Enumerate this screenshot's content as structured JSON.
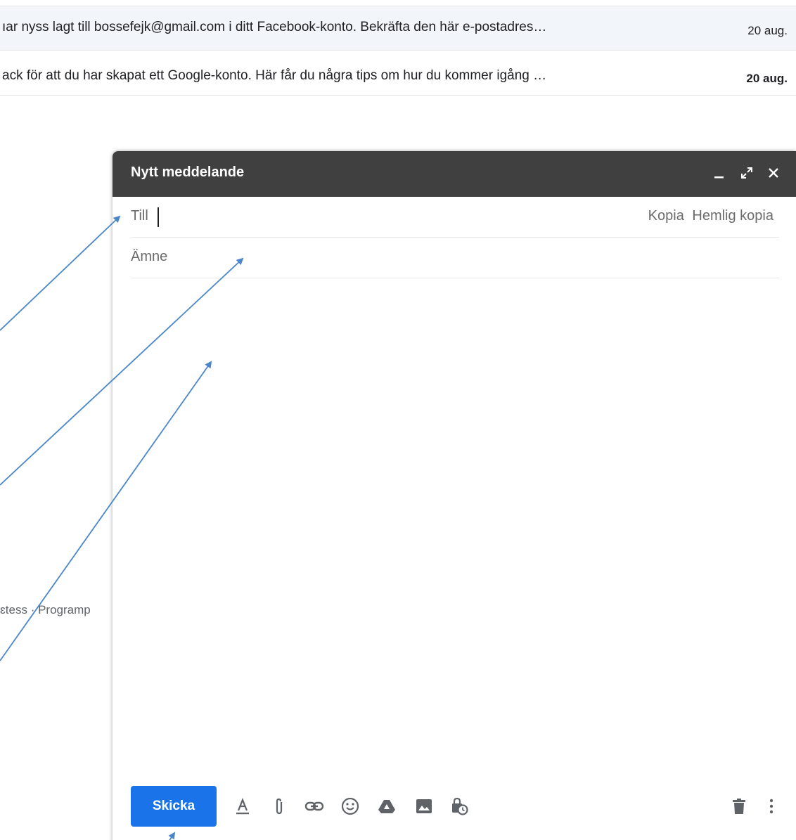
{
  "inbox": {
    "rows": [
      {
        "snippet": "ıar nyss lagt till bossefejk@gmail.com i ditt Facebook-konto. Bekräfta den här e-postadres…",
        "date": "20 aug.",
        "unread": false
      },
      {
        "snippet": "ack för att du har skapat ett Google-konto. Här får du några tips om hur du kommer igång …",
        "date": "20 aug.",
        "unread": true
      }
    ],
    "footer_text": "ɛtess · Programp"
  },
  "compose": {
    "title": "Nytt meddelande",
    "header_icons": [
      "minimize-icon",
      "fullscreen-icon",
      "close-icon"
    ],
    "to_label": "Till",
    "to_value": "",
    "cc_label": "Kopia",
    "bcc_label": "Hemlig kopia",
    "subject_placeholder": "Ämne",
    "body": "",
    "send_label": "Skicka",
    "toolbar_icons": [
      "text-format-icon",
      "attach-icon",
      "link-icon",
      "emoji-icon",
      "drive-icon",
      "image-icon",
      "confidential-mode-icon",
      "discard-icon",
      "more-options-icon"
    ]
  },
  "colors": {
    "header_bg": "#404040",
    "send_button": "#1a73e8",
    "annotation_arrow": "#4a86c8"
  }
}
